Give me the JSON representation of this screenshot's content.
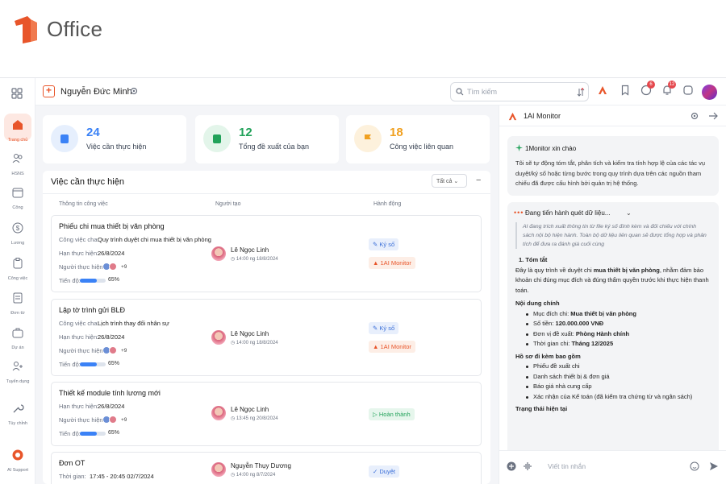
{
  "brand": {
    "name": "Office",
    "accent": "#e8552a"
  },
  "nav": [
    {
      "label": "Trang chủ",
      "icon": "home-icon",
      "active": true
    },
    {
      "label": "HSNS",
      "icon": "users-icon"
    },
    {
      "label": "Công",
      "icon": "calendar-icon"
    },
    {
      "label": "Lương",
      "icon": "dollar-icon"
    },
    {
      "label": "Công việc",
      "icon": "clipboard-icon"
    },
    {
      "label": "Đơn từ",
      "icon": "document-icon"
    },
    {
      "label": "Dự án",
      "icon": "briefcase-icon"
    },
    {
      "label": "Tuyển dụng",
      "icon": "user-plus-icon"
    },
    {
      "label": "Tùy chỉnh",
      "icon": "wrench-icon"
    },
    {
      "label": "AI Support",
      "icon": "ai-support-icon"
    }
  ],
  "header": {
    "user_name": "Nguyễn Đức Minh",
    "search_placeholder": "Tìm kiếm",
    "badge_chat": "6",
    "badge_bell": "12"
  },
  "stats": [
    {
      "value": "24",
      "label": "Việc cần thực hiện",
      "color": "#3b82f6",
      "bg": "#e6effd",
      "icon": "clipboard-check-icon"
    },
    {
      "value": "12",
      "label": "Tổng đề xuất của bạn",
      "color": "#22a25a",
      "bg": "#e3f5ea",
      "icon": "file-text-icon"
    },
    {
      "value": "18",
      "label": "Công việc liên quan",
      "color": "#f0a020",
      "bg": "#fdf1dc",
      "icon": "flag-icon"
    }
  ],
  "panel": {
    "title": "Việc cần thực hiện",
    "filter": "Tất cả",
    "columns": [
      "Thông tin công việc",
      "Người tạo",
      "Hành động"
    ]
  },
  "tasks": [
    {
      "title": "Phiếu chi mua thiết bị văn phòng",
      "fields": [
        [
          "Công việc cha:",
          "Quy trình duyệt chi mua thiết bị văn phòng"
        ],
        [
          "Hạn thực hiện:",
          "26/8/2024"
        ]
      ],
      "more": "+9",
      "progress_label": "Tiến độ:",
      "progress": "65%",
      "creator": "Lê Ngọc Linh",
      "time": "14:00 ng 18/8/2024",
      "actions": [
        {
          "label": "Ký số",
          "style": "blue",
          "icon": "sign-icon"
        },
        {
          "label": "1AI Monitor",
          "style": "orange",
          "icon": "ai-monitor-icon"
        }
      ]
    },
    {
      "title": "Lập tờ trình gửi BLĐ",
      "fields": [
        [
          "Công việc cha:",
          "Lịch trình thay đổi nhân sự"
        ],
        [
          "Hạn thực hiện:",
          "26/8/2024"
        ]
      ],
      "more": "+9",
      "progress_label": "Tiến độ:",
      "progress": "65%",
      "creator": "Lê Ngọc Linh",
      "time": "14:00 ng 18/8/2024",
      "actions": [
        {
          "label": "Ký số",
          "style": "blue",
          "icon": "sign-icon"
        },
        {
          "label": "1AI Monitor",
          "style": "orange",
          "icon": "ai-monitor-icon"
        }
      ]
    },
    {
      "title": "Thiết kế module tính lương mới",
      "fields": [
        [
          "Hạn thực hiện:",
          "26/8/2024"
        ]
      ],
      "more": "+9",
      "progress_label": "Tiến độ:",
      "progress": "65%",
      "creator": "Lê Ngọc Linh",
      "time": "13:45 ng 20/8/2024",
      "actions": [
        {
          "label": "Hoàn thành",
          "style": "green",
          "icon": "play-icon"
        }
      ]
    },
    {
      "title": "Đơn OT",
      "fields": [
        [
          "Thời gian:",
          "17:45 - 20:45  02/7/2024"
        ]
      ],
      "creator": "Nguyễn Thụy Dương",
      "time": "14:00 ng 8/7/2024",
      "actions": [
        {
          "label": "Duyệt",
          "style": "blue",
          "icon": "check-icon"
        }
      ]
    }
  ],
  "performer_label": "Người thực hiện:",
  "ai": {
    "title": "1AI Monitor",
    "greeting": "1Monitor xin chào",
    "intro": "Tôi sẽ tự động tóm tắt, phân tích và kiểm tra tính hợp lệ của các tác vụ duyệt/ký số hoặc từng bước trong quy trình dựa trên các nguồn tham chiếu đã được cấu hình bởi quản trị hệ thống.",
    "status": "Đang tiến hành quét dữ liệu...",
    "quote": "AI đang trích xuất thông tin từ file ký số đính kèm và đối chiếu với chính sách nội bộ hiện hành. Toàn bộ dữ liệu liên quan sẽ được tổng hợp và phân tích để đưa ra đánh giá cuối cùng",
    "s1": "1.  Tóm tắt",
    "summary_a": "Đây là quy trình về duyệt chi ",
    "summary_b": "mua thiết bị văn phòng",
    "summary_c": ", nhằm đảm bảo khoản chi đúng mục đích và đúng thẩm quyền trước khi thực hiện thanh toán.",
    "s2": "Nội dung chính",
    "items": [
      [
        "Mục đích chi: ",
        "Mua thiết bị văn phòng"
      ],
      [
        "Số tiền: ",
        "120.000.000 VNĐ"
      ],
      [
        "Đơn vị đề xuất: ",
        "Phòng Hành chính"
      ],
      [
        "Thời gian chi: ",
        "Tháng 12/2025"
      ]
    ],
    "s3": "Hồ sơ đi kèm bao gồm",
    "docs": [
      "Phiếu đề xuất chi",
      "Danh sách thiết bị & đơn giá",
      "Báo giá nhà cung cấp",
      "Xác nhận của Kế toán (đã kiểm tra chứng từ và ngân sách)"
    ],
    "s4": "Trạng thái hiện tại",
    "input_placeholder": "Viết tin nhắn"
  }
}
